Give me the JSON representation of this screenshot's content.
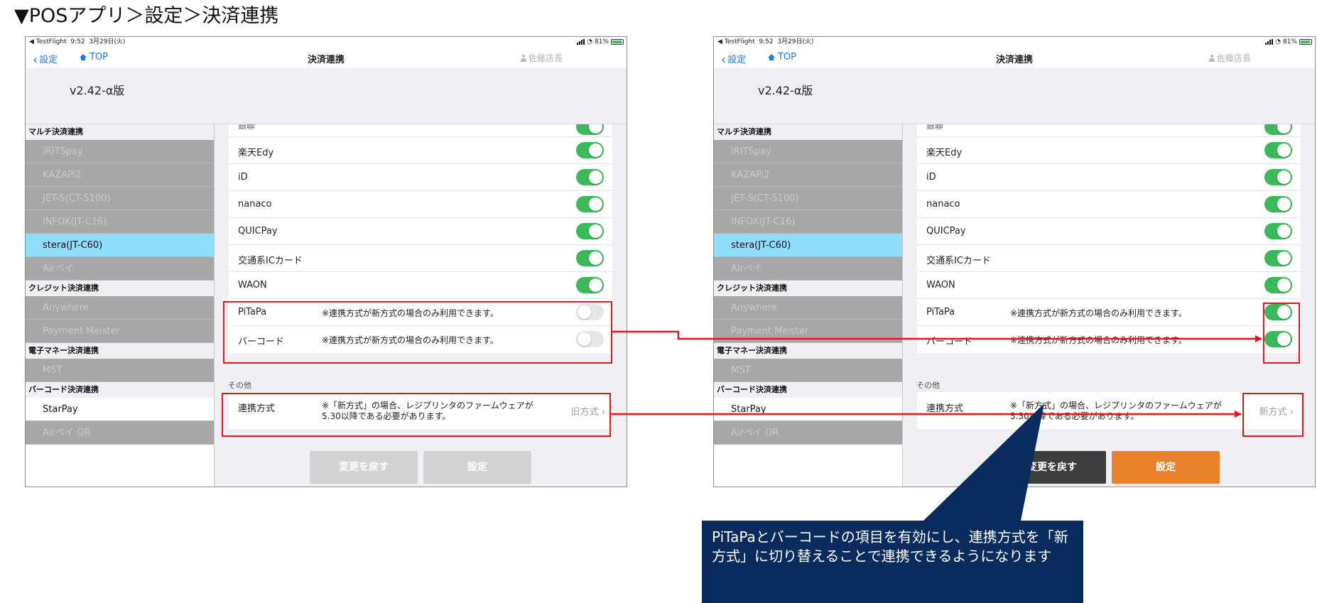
{
  "page_heading": "▼POSアプリ＞設定＞決済連携",
  "colors": {
    "accent_blue": "#1a7ae8",
    "toggle_on": "#3cb95a",
    "toggle_off": "#e6e6e6",
    "selected_item": "#8fdcfb",
    "highlight_red": "#e2161b",
    "save_orange": "#e8812a",
    "reset_dark": "#3d3d3d",
    "callout_navy": "#0a2b5e"
  },
  "screens": [
    {
      "status": {
        "carrier": "◀ TestFlight",
        "time": "9:52",
        "date": "3月29日(火)",
        "battery": "81%"
      },
      "nav": {
        "back": "設定",
        "top": "TOP",
        "title": "決済連携",
        "user": "佐藤店長"
      },
      "version": "v2.42-α版",
      "sidebar": {
        "sections": [
          {
            "header": "マルチ決済連携",
            "items": [
              {
                "label": "iRITSpay",
                "state": "disabled"
              },
              {
                "label": "KAZAPi2",
                "state": "disabled"
              },
              {
                "label": "JET-S(CT-5100)",
                "state": "disabled"
              },
              {
                "label": "INFOX(JT-C16)",
                "state": "disabled"
              },
              {
                "label": "stera(JT-C60)",
                "state": "selected"
              },
              {
                "label": "Airペイ",
                "state": "disabled"
              }
            ]
          },
          {
            "header": "クレジット決済連携",
            "items": [
              {
                "label": "Anywhere",
                "state": "disabled"
              },
              {
                "label": "Payment Meister",
                "state": "disabled"
              }
            ]
          },
          {
            "header": "電子マネー決済連携",
            "items": [
              {
                "label": "MST",
                "state": "disabled"
              }
            ]
          },
          {
            "header": "バーコード決済連携",
            "items": [
              {
                "label": "StarPay",
                "state": "active"
              },
              {
                "label": "Airペイ QR",
                "state": "disabled"
              }
            ]
          }
        ]
      },
      "first_row_label": "銀聯",
      "rows": [
        {
          "label": "楽天Edy",
          "note": "",
          "on": true
        },
        {
          "label": "iD",
          "note": "",
          "on": true
        },
        {
          "label": "nanaco",
          "note": "",
          "on": true
        },
        {
          "label": "QUICPay",
          "note": "",
          "on": true
        },
        {
          "label": "交通系ICカード",
          "note": "",
          "on": true
        },
        {
          "label": "WAON",
          "note": "",
          "on": true
        }
      ],
      "extra_rows": [
        {
          "label": "PiTaPa",
          "note": "※連携方式が新方式の場合のみ利用できます。",
          "on": false
        },
        {
          "label": "バーコード",
          "note": "※連携方式が新方式の場合のみ利用できます。",
          "on": false
        }
      ],
      "other_section": "その他",
      "method": {
        "label": "連携方式",
        "note": "※「新方式」の場合、レジプリンタのファームウェアが5.30以降である必要があります。",
        "value": "旧方式"
      },
      "buttons": {
        "reset": "変更を戻す",
        "save": "設定",
        "enabled": false
      }
    },
    {
      "status": {
        "carrier": "◀ TestFlight",
        "time": "9:52",
        "date": "3月29日(火)",
        "battery": "81%"
      },
      "nav": {
        "back": "設定",
        "top": "TOP",
        "title": "決済連携",
        "user": "佐藤店長"
      },
      "version": "v2.42-α版",
      "sidebar": {
        "sections": [
          {
            "header": "マルチ決済連携",
            "items": [
              {
                "label": "iRITSpay",
                "state": "disabled"
              },
              {
                "label": "KAZAPi2",
                "state": "disabled"
              },
              {
                "label": "JET-S(CT-5100)",
                "state": "disabled"
              },
              {
                "label": "INFOX(JT-C16)",
                "state": "disabled"
              },
              {
                "label": "stera(JT-C60)",
                "state": "selected"
              },
              {
                "label": "Airペイ",
                "state": "disabled"
              }
            ]
          },
          {
            "header": "クレジット決済連携",
            "items": [
              {
                "label": "Anywhere",
                "state": "disabled"
              },
              {
                "label": "Payment Meister",
                "state": "disabled"
              }
            ]
          },
          {
            "header": "電子マネー決済連携",
            "items": [
              {
                "label": "MST",
                "state": "disabled"
              }
            ]
          },
          {
            "header": "バーコード決済連携",
            "items": [
              {
                "label": "StarPay",
                "state": "active"
              },
              {
                "label": "Airペイ QR",
                "state": "disabled"
              }
            ]
          }
        ]
      },
      "first_row_label": "銀聯",
      "rows": [
        {
          "label": "楽天Edy",
          "note": "",
          "on": true
        },
        {
          "label": "iD",
          "note": "",
          "on": true
        },
        {
          "label": "nanaco",
          "note": "",
          "on": true
        },
        {
          "label": "QUICPay",
          "note": "",
          "on": true
        },
        {
          "label": "交通系ICカード",
          "note": "",
          "on": true
        },
        {
          "label": "WAON",
          "note": "",
          "on": true
        }
      ],
      "extra_rows": [
        {
          "label": "PiTaPa",
          "note": "※連携方式が新方式の場合のみ利用できます。",
          "on": true
        },
        {
          "label": "バーコード",
          "note": "※連携方式が新方式の場合のみ利用できます。",
          "on": true
        }
      ],
      "other_section": "その他",
      "method": {
        "label": "連携方式",
        "note": "※「新方式」の場合、レジプリンタのファームウェアが5.30以降である必要があります。",
        "value": "新方式"
      },
      "buttons": {
        "reset": "変更を戻す",
        "save": "設定",
        "enabled": true
      }
    }
  ],
  "callout": "PiTaPaとバーコードの項目を有効にし、連携方式を「新方式」に切り替えることで連携できるようになります"
}
